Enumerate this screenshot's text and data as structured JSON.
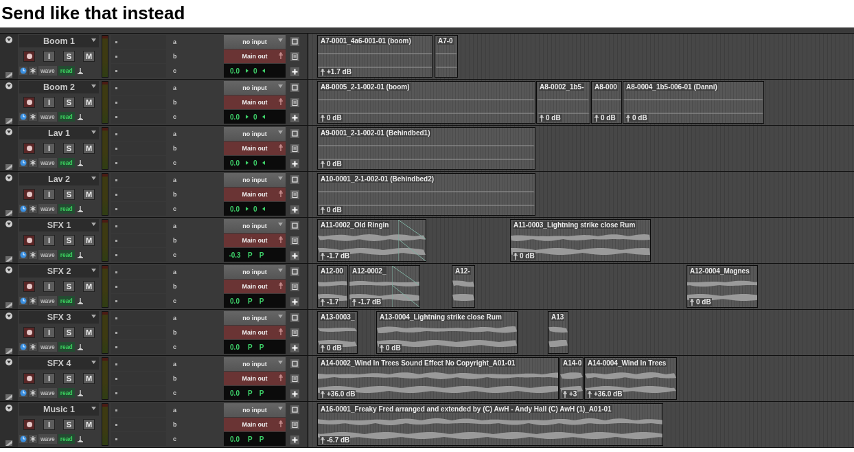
{
  "heading": "Send like that instead",
  "tracks": [
    {
      "name": "Boom 1",
      "buttons": [
        "I",
        "S",
        "M"
      ],
      "sends": [
        "a",
        "b",
        "c"
      ],
      "input": "no input",
      "output": "Main out",
      "view": "wave",
      "automation": "read",
      "volume": "0.0",
      "kind": "mono",
      "pan": [
        "0"
      ],
      "clips": [
        {
          "name": "A7-0001_4a6-001-01 (boom)",
          "gain": "+1.7 dB",
          "fade_out": false
        },
        {
          "name": "A7-0",
          "fade_out": false
        }
      ]
    },
    {
      "name": "Boom 2",
      "buttons": [
        "I",
        "S",
        "M"
      ],
      "sends": [
        "a",
        "b",
        "c"
      ],
      "input": "no input",
      "output": "Main out",
      "view": "wave",
      "automation": "read",
      "volume": "0.0",
      "kind": "mono",
      "pan": [
        "0"
      ],
      "clips": [
        {
          "name": "A8-0005_2-1-002-01 (boom)",
          "gain": "0 dB",
          "fade_out": false
        },
        {
          "name": "A8-0002_1b5-",
          "gain": "0 dB",
          "fade_out": false
        },
        {
          "name": "A8-000",
          "gain": "0 dB",
          "fade_out": false
        },
        {
          "name": "A8-0004_1b5-006-01 (Danni)",
          "gain": "0 dB",
          "fade_out": false
        }
      ]
    },
    {
      "name": "Lav 1",
      "buttons": [
        "I",
        "S",
        "M"
      ],
      "sends": [
        "a",
        "b",
        "c"
      ],
      "input": "no input",
      "output": "Main out",
      "view": "wave",
      "automation": "read",
      "volume": "0.0",
      "kind": "mono",
      "pan": [
        "0"
      ],
      "clips": [
        {
          "name": "A9-0001_2-1-002-01 (Behindbed1)",
          "gain": "0 dB",
          "fade_out": false
        }
      ]
    },
    {
      "name": "Lav 2",
      "buttons": [
        "I",
        "S",
        "M"
      ],
      "sends": [
        "a",
        "b",
        "c"
      ],
      "input": "no input",
      "output": "Main out",
      "view": "wave",
      "automation": "read",
      "volume": "0.0",
      "kind": "mono",
      "pan": [
        "0"
      ],
      "clips": [
        {
          "name": "A10-0001_2-1-002-01 (Behindbed2)",
          "gain": "0 dB",
          "fade_out": false
        }
      ]
    },
    {
      "name": "SFX 1",
      "buttons": [
        "I",
        "S",
        "M"
      ],
      "sends": [
        "a",
        "b",
        "c"
      ],
      "input": "no input",
      "output": "Main out",
      "view": "wave",
      "automation": "read",
      "volume": "-0.3",
      "kind": "stereo",
      "pan": [
        "P",
        "P"
      ],
      "clips": [
        {
          "name": "A11-0002_Old Ringin",
          "gain": "-1.7 dB",
          "fade_out": true
        },
        {
          "name": "A11-0003_Lightning strike close Rum",
          "gain": "0 dB",
          "fade_out": false
        }
      ]
    },
    {
      "name": "SFX 2",
      "buttons": [
        "I",
        "S",
        "M"
      ],
      "sends": [
        "a",
        "b",
        "c"
      ],
      "input": "no input",
      "output": "Main out",
      "view": "wave",
      "automation": "read",
      "volume": "0.0",
      "kind": "stereo",
      "pan": [
        "P",
        "P"
      ],
      "clips": [
        {
          "name": "A12-00",
          "gain": "-1.7",
          "fade_out": false
        },
        {
          "name": "A12-0002_",
          "gain": "-1.7 dB",
          "fade_out": true
        },
        {
          "name": "A12-",
          "fade_out": false
        },
        {
          "name": "A12-0004_Magnes",
          "gain": "0 dB",
          "fade_out": false
        }
      ]
    },
    {
      "name": "SFX 3",
      "buttons": [
        "I",
        "S",
        "M"
      ],
      "sends": [
        "a",
        "b",
        "c"
      ],
      "input": "no input",
      "output": "Main out",
      "view": "wave",
      "automation": "read",
      "volume": "0.0",
      "kind": "stereo",
      "pan": [
        "P",
        "P"
      ],
      "clips": [
        {
          "name": "A13-0003_",
          "gain": "0 dB",
          "fade_out": false
        },
        {
          "name": "A13-0004_Lightning strike close Rum",
          "gain": "0 dB",
          "fade_out": false
        },
        {
          "name": "A13",
          "fade_out": false
        }
      ]
    },
    {
      "name": "SFX 4",
      "buttons": [
        "I",
        "S",
        "M"
      ],
      "sends": [
        "a",
        "b",
        "c"
      ],
      "input": "no input",
      "output": "Main out",
      "view": "wave",
      "automation": "read",
      "volume": "0.0",
      "kind": "stereo",
      "pan": [
        "P",
        "P"
      ],
      "clips": [
        {
          "name": "A14-0002_Wind In Trees Sound Effect No Copyright_A01-01",
          "gain": "+36.0 dB",
          "fade_out": false
        },
        {
          "name": "A14-0",
          "gain": "+3",
          "fade_out": false
        },
        {
          "name": "A14-0004_Wind In Trees",
          "gain": "+36.0 dB",
          "fade_out": false
        }
      ]
    },
    {
      "name": "Music 1",
      "buttons": [
        "I",
        "S",
        "M"
      ],
      "sends": [
        "a",
        "b",
        "c"
      ],
      "input": "no input",
      "output": "Main out",
      "view": "wave",
      "automation": "read",
      "volume": "0.0",
      "kind": "stereo",
      "pan": [
        "P",
        "P"
      ],
      "clips": [
        {
          "name": "A16-0001_Freaky Fred arranged and extended by (C) AwH - Andy Hall (C) AwH (1)_A01-01",
          "gain": "-6.7 dB",
          "fade_out": false
        }
      ]
    }
  ]
}
